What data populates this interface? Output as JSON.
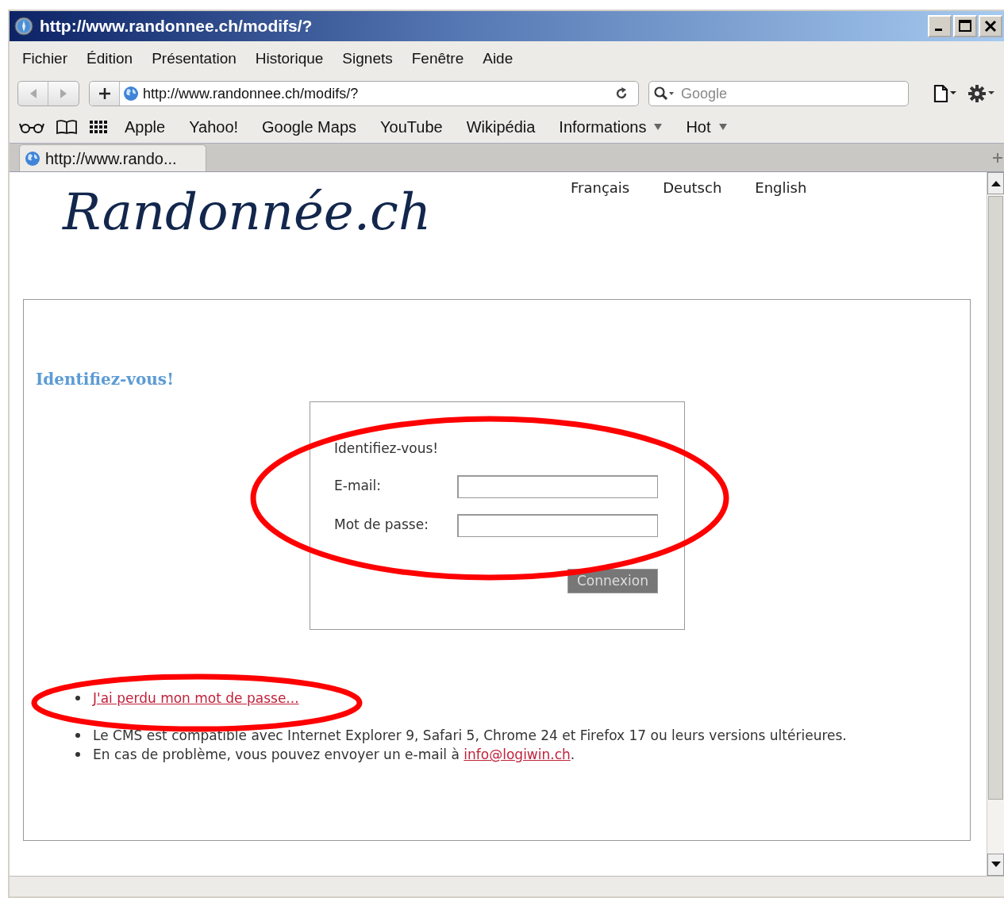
{
  "window": {
    "title": "http://www.randonnee.ch/modifs/?"
  },
  "menu": [
    "Fichier",
    "Édition",
    "Présentation",
    "Historique",
    "Signets",
    "Fenêtre",
    "Aide"
  ],
  "toolbar": {
    "address": "http://www.randonnee.ch/modifs/?",
    "search": {
      "placeholder": "Google"
    }
  },
  "bookmarks": [
    {
      "label": "Apple",
      "kind": "link"
    },
    {
      "label": "Yahoo!",
      "kind": "link"
    },
    {
      "label": "Google Maps",
      "kind": "link"
    },
    {
      "label": "YouTube",
      "kind": "link"
    },
    {
      "label": "Wikipédia",
      "kind": "link"
    },
    {
      "label": "Informations",
      "kind": "menu"
    },
    {
      "label": "Hot",
      "kind": "menu"
    }
  ],
  "tabs": [
    {
      "label": "http://www.rando...",
      "selected": true
    }
  ],
  "page": {
    "logo": "Randonnée.ch",
    "languages": [
      "Français",
      "Deutsch",
      "English"
    ],
    "heading": "Identifiez-vous!",
    "login": {
      "title": "Identifiez-vous!",
      "fields": [
        {
          "label": "E-mail:"
        },
        {
          "label": "Mot de passe:"
        }
      ],
      "button": "Connexion"
    },
    "notes": [
      {
        "kind": "link",
        "text": "J'ai perdu mon mot de passe..."
      },
      {
        "kind": "text",
        "text": "Le CMS est compatible avec Internet Explorer 9, Safari 5, Chrome 24 et Firefox 17 ou leurs versions ultérieures."
      },
      {
        "kind": "mail",
        "text": "En cas de problème, vous pouvez envoyer un e-mail à ",
        "link": "info@logiwin.ch",
        "after": "."
      }
    ]
  },
  "annotations": [
    {
      "kind": "ellipse"
    },
    {
      "kind": "ellipse"
    }
  ]
}
